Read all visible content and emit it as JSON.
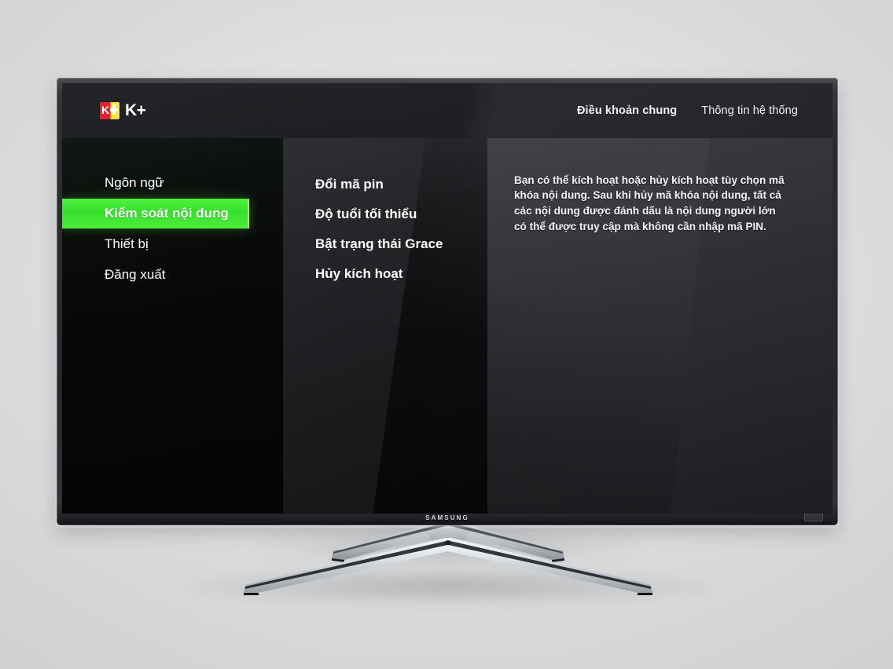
{
  "device": {
    "brand_logo": "SAMSUNG",
    "type": "television"
  },
  "header": {
    "brand_mark_icon": "kplus-logo-icon",
    "brand_mark_k": "K",
    "brand_name": "K+",
    "nav": [
      {
        "label": "Điều khoản chung",
        "active": true
      },
      {
        "label": "Thông tin hệ thống",
        "active": false
      }
    ]
  },
  "sidebar": {
    "items": [
      {
        "label": "Ngôn ngữ",
        "selected": false
      },
      {
        "label": "Kiểm soát nội dung",
        "selected": true
      },
      {
        "label": "Thiết bị",
        "selected": false
      },
      {
        "label": "Đăng xuất",
        "selected": false
      }
    ]
  },
  "submenu": {
    "items": [
      {
        "label": "Đổi mã pin"
      },
      {
        "label": "Độ tuổi tối thiểu"
      },
      {
        "label": "Bật trạng thái Grace"
      },
      {
        "label": "Hủy kích hoạt"
      }
    ]
  },
  "description": {
    "text": "Bạn có thể kích hoạt hoặc hủy kích hoạt tùy chọn mã khóa nội dung. Sau khi hủy mã khóa nội dung, tất cả các nội dung được đánh dấu là nội dung người lớn có thể được truy cập mà không cần nhập mã PIN."
  },
  "colors": {
    "highlight_green": "#3fe92f",
    "highlight_border": "#e4f764",
    "brand_red": "#e8192c",
    "brand_yellow": "#f5e533",
    "text_white": "#ffffff",
    "background": "#dcdcdc"
  }
}
